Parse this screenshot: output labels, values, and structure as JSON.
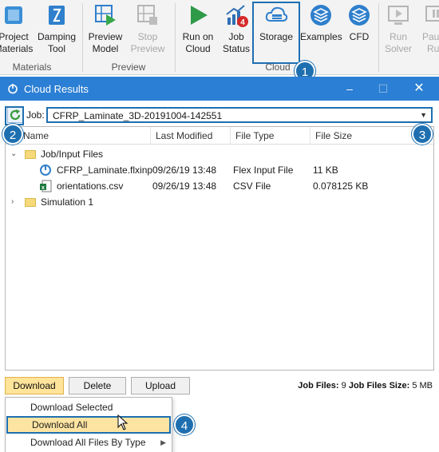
{
  "ribbon": {
    "buttons": [
      {
        "label_line1": "Project",
        "label_line2": "Materials"
      },
      {
        "label_line1": "Damping",
        "label_line2": "Tool"
      },
      {
        "label_line1": "Preview",
        "label_line2": "Model"
      },
      {
        "label_line1": "Stop",
        "label_line2": "Preview"
      },
      {
        "label_line1": "Run on",
        "label_line2": "Cloud"
      },
      {
        "label_line1": "Job",
        "label_line2": "Status"
      },
      {
        "label_line1": "Storage",
        "label_line2": ""
      },
      {
        "label_line1": "Examples",
        "label_line2": ""
      },
      {
        "label_line1": "CFD",
        "label_line2": ""
      },
      {
        "label_line1": "Run",
        "label_line2": "Solver"
      },
      {
        "label_line1": "Pause",
        "label_line2": "Run"
      }
    ],
    "job_status_badge": "4",
    "groups": [
      "Materials",
      "Preview",
      "Cloud"
    ]
  },
  "callouts": [
    "1",
    "2",
    "3",
    "4"
  ],
  "dialog": {
    "title": "Cloud Results",
    "job_label": "Job:",
    "job_value": "CFRP_Laminate_3D-20191004-142551",
    "columns": [
      "Name",
      "Last Modified",
      "File Type",
      "File Size"
    ],
    "rows": [
      {
        "name": "Job/Input Files",
        "modified": "",
        "type": "",
        "size": ""
      },
      {
        "name": "CFRP_Laminate.flxinp",
        "modified": "09/26/19 13:48",
        "type": "Flex Input File",
        "size": "11 KB"
      },
      {
        "name": "orientations.csv",
        "modified": "09/26/19 13:48",
        "type": "CSV File",
        "size": "0.078125 KB"
      },
      {
        "name": "Simulation 1",
        "modified": "",
        "type": "",
        "size": ""
      }
    ],
    "buttons": {
      "download": "Download",
      "delete": "Delete",
      "upload": "Upload"
    },
    "summary": {
      "files_label": "Job Files:",
      "files_value": "9",
      "size_label": "Job Files Size:",
      "size_value": "5 MB"
    }
  },
  "menu": {
    "items": [
      "Download Selected",
      "Download All",
      "Download All Files By Type"
    ]
  },
  "colors": {
    "accent": "#1e6fb0",
    "titlebar": "#2b7fd4",
    "highlight": "#fde4a2"
  }
}
